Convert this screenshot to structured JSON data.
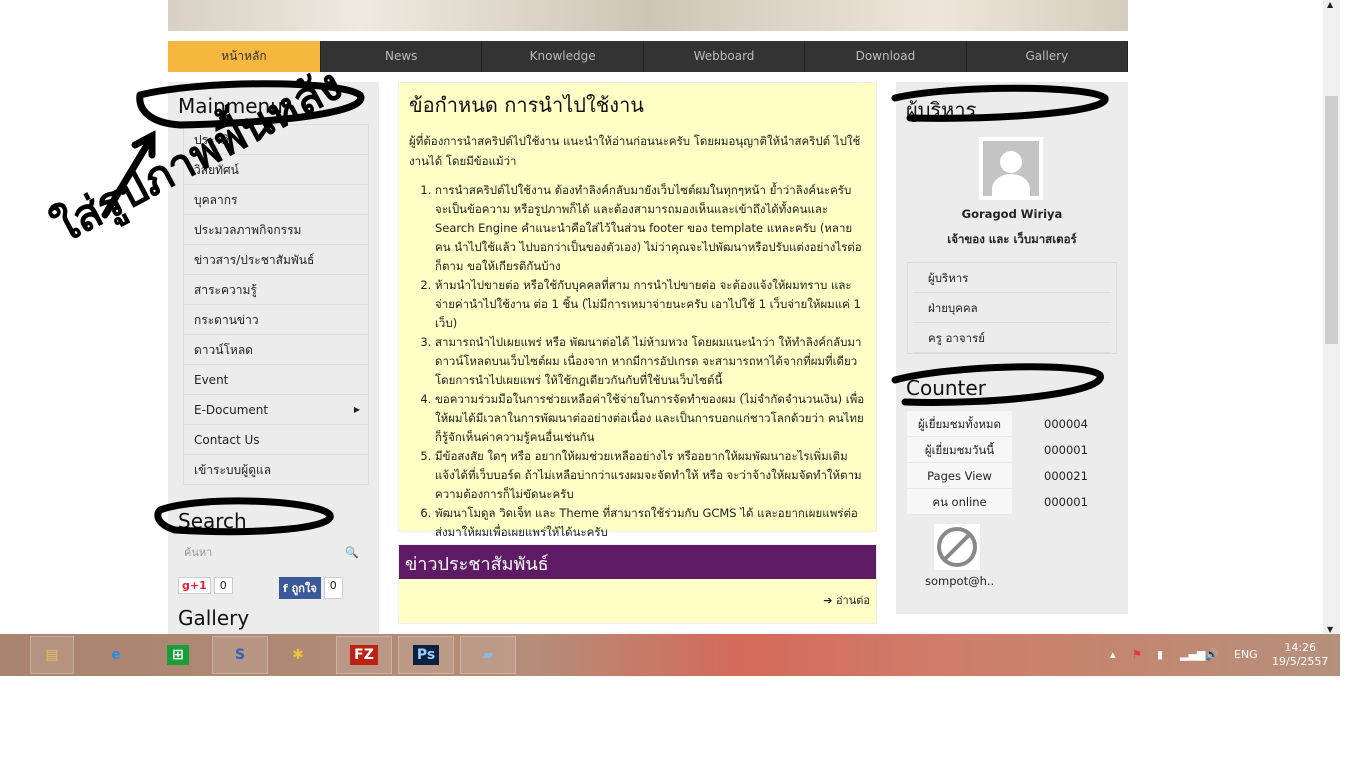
{
  "nav": [
    "หน้าหลัก",
    "News",
    "Knowledge",
    "Webboard",
    "Download",
    "Gallery"
  ],
  "left": {
    "mainmenu_title": "Mainmenu",
    "menu": [
      "ประวัติ",
      "วิสัยทัศน์",
      "บุคลากร",
      "ประมวลภาพกิจกรรม",
      "ข่าวสาร/ประชาสัมพันธ์",
      "สาระความรู้",
      "กระดานข่าว",
      "ดาวน์โหลด",
      "Event",
      "E-Document",
      "Contact Us",
      "เข้าระบบผู้ดูแล"
    ],
    "search_title": "Search",
    "search_placeholder": "ค้นหา",
    "gplus_label": "g+1",
    "gplus_count": "0",
    "fb_label": "ถูกใจ",
    "fb_count": "0",
    "gallery_title": "Gallery"
  },
  "main": {
    "title": "ข้อกำหนด การนำไปใช้งาน",
    "intro": "ผู้ที่ต้องการนำสคริปต์ไปใช้งาน แนะนำให้อ่านก่อนนะครับ โดยผมอนุญาติให้นำสคริปต์ ไปใช้งานได้ โดยมีข้อแม้ว่า",
    "rules": [
      "การนำสคริปต์ไปใช้งาน ต้องทำลิงค์กลับมายังเว็บไซต์ผมในทุกๆหน้า ย้ำว่าลิงค์นะครับ จะเป็นข้อความ หรือรูปภาพก็ได้ และต้องสามารถมองเห็นและเข้าถึงได้ทั้งคนและ Search Engine คำแนะนำคือใส่ไว้ในส่วน footer ของ template แหละครับ (หลายคน นำไปใช้แล้ว ไปบอกว่าเป็นของตัวเอง) ไม่ว่าคุณจะไปพัฒนาหรือปรับแต่งอย่างไรต่อก็ตาม ขอให้เกียรติกันบ้าง",
      "ห้ามนำไปขายต่อ หรือใช้กับบุคคลที่สาม การนำไปขายต่อ จะต้องแจ้งให้ผมทราบ และจ่ายค่านำไปใช้งาน ต่อ 1 ชิ้น (ไม่มีการเหมาจ่ายนะครับ เอาไปใช้ 1 เว็บจ่ายให้ผมแค่ 1 เว็บ)",
      "สามารถนำไปเผยแพร่ หรือ พัฒนาต่อได้ ไม่ห้ามหวง โดยผมแนะนำว่า ให้ทำลิงค์กลับมาดาวน์โหลดบนเว็บไซต์ผม เนื่องจาก หากมีการอัปเกรด จะสามารถหาได้จากที่ผมที่เดียว โดยการนำไปเผยแพร่ ให้ใช้กฎเดียวกันกับที่ใช้บนเว็บไซต์นี้",
      "ขอความร่วมมือในการช่วยเหลือค่าใช้จ่ายในการจัดทำของผม (ไม่จำกัดจำนวนเงิน) เพื่อให้ผมได้มีเวลาในการพัฒนาต่ออย่างต่อเนื่อง และเป็นการบอกแก่ชาวโลกด้วยว่า คนไทยก็รู้จักเห็นค่าความรู้คนอื่นเช่นกัน",
      "มีข้อสงสัย ใดๆ หรือ อยากให้ผมช่วยเหลืออย่างไร หรืออยากให้ผมพัฒนาอะไรเพิ่มเติม แจ้งได้ที่เว็บบอร์ด ถ้าไม่เหลือบ่ากว่าแรงผมจะจัดทำให้ หรือ จะว่าจ้างให้ผมจัดทำให้ตามความต้องการก็ไม่ขัดนะครับ",
      "พัฒนาโมดูล วิดเจ็ท และ Theme ที่สามารถใช้ร่วมกับ GCMS ได้ และอยากเผยแพร่ต่อ ส่งมาให้ผมเพื่อเผยแพร่ให้ได้นะครับ"
    ],
    "news_title": "ข่าวประชาสัมพันธ์",
    "read_more": "อ่านต่อ"
  },
  "right": {
    "admin_title": "ผู้บริหาร",
    "name": "Goragod Wiriya",
    "role": "เจ้าของ และ เว็บมาสเตอร์",
    "submenu": [
      "ผู้บริหาร",
      "ฝ่ายบุคคล",
      "ครู อาจารย์"
    ],
    "counter_title": "Counter",
    "counter": [
      [
        "ผู้เยี่ยมชมทั้งหมด",
        "000004"
      ],
      [
        "ผู้เยี่ยมชมวันนี้",
        "000001"
      ],
      [
        "Pages View",
        "000021"
      ],
      [
        "คน online",
        "000001"
      ]
    ],
    "online_user": "sompot@h.."
  },
  "annotation": "ใส่รูปภาพพื้นหลัง",
  "taskbar": {
    "lang": "ENG",
    "time": "14:26",
    "date": "19/5/2557",
    "apps": [
      "file-explorer",
      "internet-explorer",
      "store",
      "browser",
      "app",
      "filezilla",
      "photoshop",
      "notepad"
    ]
  }
}
